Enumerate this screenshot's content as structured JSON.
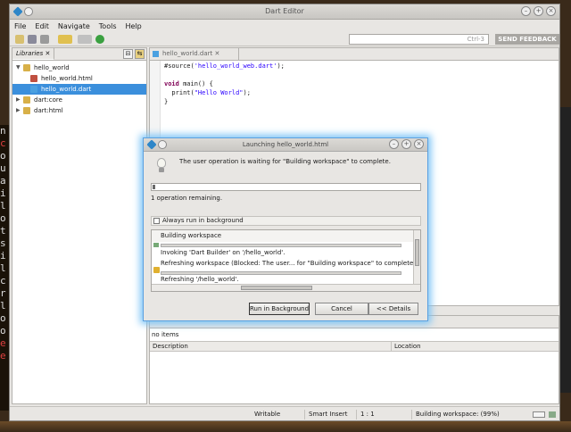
{
  "window": {
    "title": "Dart Editor",
    "menu": [
      "File",
      "Edit",
      "Navigate",
      "Tools",
      "Help"
    ],
    "search_placeholder": "Ctrl-3",
    "send_feedback": "SEND FEEDBACK"
  },
  "libraries": {
    "tab_label": "Libraries",
    "items": [
      {
        "label": "hello_world",
        "icon": "library-icon",
        "expanded": true,
        "level": 0
      },
      {
        "label": "hello_world.html",
        "icon": "html-file-icon",
        "level": 1
      },
      {
        "label": "hello_world.dart",
        "icon": "dart-file-icon",
        "level": 1,
        "selected": true
      },
      {
        "label": "dart:core",
        "icon": "library-icon",
        "expanded": false,
        "level": 0
      },
      {
        "label": "dart:html",
        "icon": "library-icon",
        "expanded": false,
        "level": 0
      }
    ]
  },
  "editor": {
    "tab_label": "hello_world.dart",
    "lines": [
      {
        "parts": [
          {
            "t": "#source(",
            "c": ""
          },
          {
            "t": "'hello_world_web.dart'",
            "c": "str"
          },
          {
            "t": ");",
            "c": ""
          }
        ]
      },
      {
        "parts": [
          {
            "t": "",
            "c": ""
          }
        ]
      },
      {
        "parts": [
          {
            "t": "void",
            "c": "kw"
          },
          {
            "t": " main() {",
            "c": ""
          }
        ]
      },
      {
        "parts": [
          {
            "t": "  print(",
            "c": ""
          },
          {
            "t": "\"Hello World\"",
            "c": "str"
          },
          {
            "t": ");",
            "c": ""
          }
        ]
      },
      {
        "parts": [
          {
            "t": "}",
            "c": ""
          }
        ]
      }
    ]
  },
  "problems": {
    "count_text": "no items",
    "col_description": "Description",
    "col_location": "Location"
  },
  "status": {
    "writable": "Writable",
    "insert_mode": "Smart Insert",
    "position": "1 : 1",
    "progress": "Building workspace: (99%)"
  },
  "dialog": {
    "title": "Launching hello_world.html",
    "message": "The user operation is waiting for \"Building workspace\" to complete.",
    "progress_fraction": 0.01,
    "remaining": "1 operation remaining.",
    "always_background": "Always run in background",
    "jobs": [
      "Building workspace",
      "Invoking 'Dart Builder' on '/hello_world'.",
      "Refreshing workspace (Blocked: The user... for \"Building workspace\" to complete.)",
      "Refreshing '/hello_world'."
    ],
    "btn_background": "Run in Background",
    "btn_cancel": "Cancel",
    "btn_details": "<< Details"
  }
}
